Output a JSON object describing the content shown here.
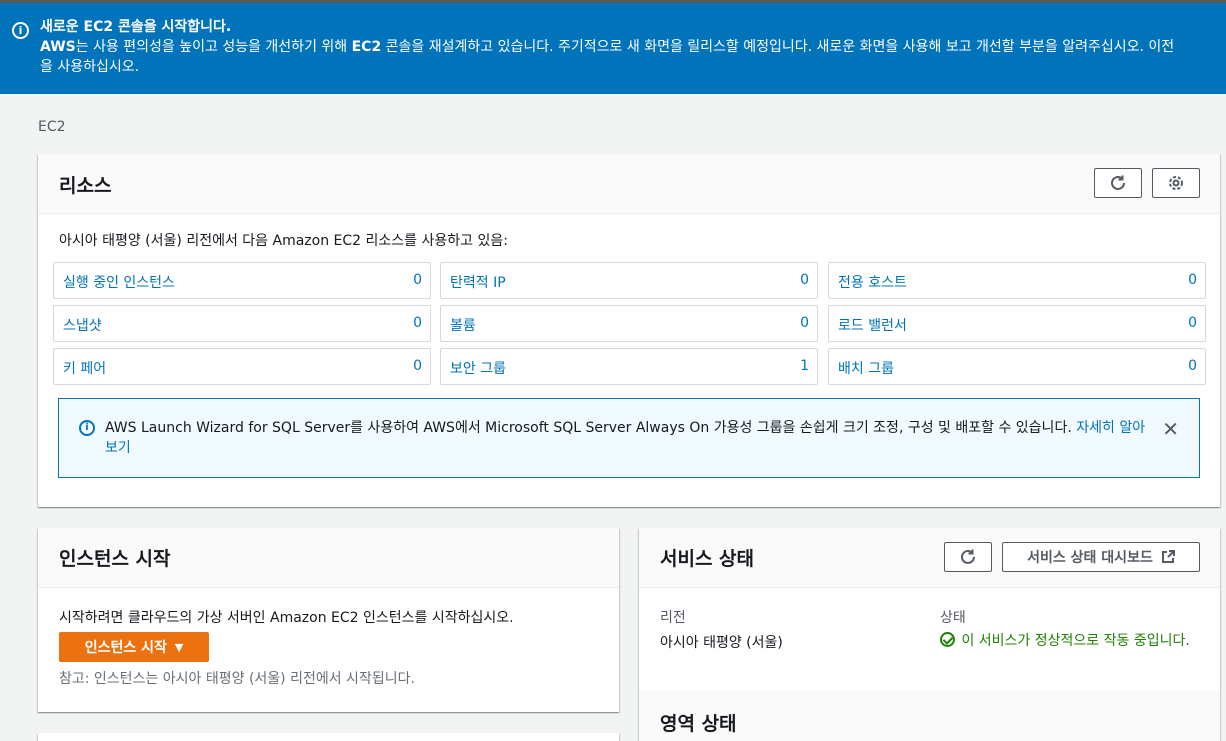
{
  "banner": {
    "icon": "info-icon",
    "title": "새로운 EC2 콘솔을 시작합니다.",
    "line1_bold": "AWS",
    "line1_a": "는 사용 편의성을 높이고 성능을 개선하기 위해 ",
    "line1_bold2": "EC2",
    "line1_b": " 콘솔을 재설계하고 있습니다. 주기적으로 새 화면을 릴리스할 예정입니다. 새로운 화면을 사용해 보고 개선할 부분을 알려주십시오. 이전",
    "line2": "을 사용하십시오."
  },
  "breadcrumb": "EC2",
  "resources": {
    "title": "리소스",
    "refresh_icon": "refresh-icon",
    "settings_icon": "gear-icon",
    "intro": "아시아 태평양 (서울) 리전에서 다음 Amazon EC2 리소스를 사용하고 있음:",
    "items": [
      {
        "label": "실행 중인 인스턴스",
        "value": "0"
      },
      {
        "label": "탄력적 IP",
        "value": "0"
      },
      {
        "label": "전용 호스트",
        "value": "0"
      },
      {
        "label": "스냅샷",
        "value": "0"
      },
      {
        "label": "볼륨",
        "value": "0"
      },
      {
        "label": "로드 밸런서",
        "value": "0"
      },
      {
        "label": "키 페어",
        "value": "0"
      },
      {
        "label": "보안 그룹",
        "value": "1"
      },
      {
        "label": "배치 그룹",
        "value": "0"
      }
    ],
    "alert": {
      "text": "AWS Launch Wizard for SQL Server를 사용하여 AWS에서 Microsoft SQL Server Always On 가용성 그룹을 손쉽게 크기 조정, 구성 및 배포할 수 있습니다. ",
      "link": "자세히 알아보기",
      "close": "✕"
    }
  },
  "launch": {
    "title": "인스턴스 시작",
    "text": "시작하려면 클라우드의 가상 서버인 Amazon EC2 인스턴스를 시작하십시오.",
    "button": "인스턴스 시작",
    "button_caret": "▼",
    "note": "참고: 인스턴스는 아시아 태평양 (서울) 리전에서 시작됩니다."
  },
  "service_health": {
    "title": "서비스 상태",
    "dashboard_button": "서비스 상태 대시보드",
    "external_icon": "external-link-icon",
    "region_label": "리전",
    "region_value": "아시아 태평양 (서울)",
    "status_label": "상태",
    "status_value": "이 서비스가 정상적으로 작동 중입니다.",
    "zone_title": "영역 상태"
  }
}
